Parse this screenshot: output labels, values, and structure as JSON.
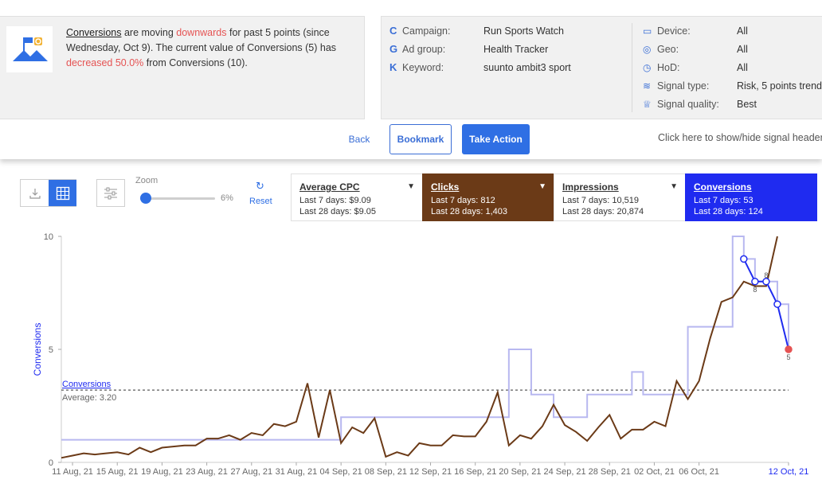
{
  "signal": {
    "metric_link": "Conversions",
    "text_1": " are moving ",
    "direction": "downwards",
    "text_2": " for past 5 points (since Wednesday, Oct 9). The current value of Conversions (5) has ",
    "change": "decreased 50.0%",
    "text_3": " from Conversions (10)."
  },
  "meta_left": [
    {
      "icon": "C",
      "label": "Campaign:",
      "value": "Run Sports Watch"
    },
    {
      "icon": "G",
      "label": "Ad group:",
      "value": "Health Tracker"
    },
    {
      "icon": "K",
      "label": "Keyword:",
      "value": "suunto ambit3 sport"
    }
  ],
  "meta_right": [
    {
      "icon": "device-icon",
      "label": "Device:",
      "value": "All"
    },
    {
      "icon": "location-pin-icon",
      "label": "Geo:",
      "value": "All"
    },
    {
      "icon": "clock-icon",
      "label": "HoD:",
      "value": "All"
    },
    {
      "icon": "signal-icon",
      "label": "Signal type:",
      "value": "Risk, 5 points trend"
    },
    {
      "icon": "trophy-icon",
      "label": "Signal quality:",
      "value": "Best"
    }
  ],
  "actions": {
    "back": "Back",
    "bookmark": "Bookmark",
    "take_action": "Take Action",
    "toggle_hint": "Click here to show/hide signal header"
  },
  "toolbar": {
    "zoom_label": "Zoom",
    "zoom_value": "6%",
    "zoom_level": 0.06,
    "reset": "Reset"
  },
  "metrics": [
    {
      "name": "Average CPC",
      "last7": "Last 7 days: $9.09",
      "last28": "Last 28 days: $9.05",
      "style": "plain"
    },
    {
      "name": "Clicks",
      "last7": "Last 7 days: 812",
      "last28": "Last 28 days: 1,403",
      "style": "clicks"
    },
    {
      "name": "Impressions",
      "last7": "Last 7 days: 10,519",
      "last28": "Last 28 days: 20,874",
      "style": "plain"
    },
    {
      "name": "Conversions",
      "last7": "Last 7 days: 53",
      "last28": "Last 28 days: 124",
      "style": "conv"
    }
  ],
  "chart_data": {
    "type": "line",
    "ylabel": "Conversions",
    "ylim": [
      0,
      10
    ],
    "yticks": [
      0,
      5,
      10
    ],
    "x_tick_labels": [
      "11 Aug, 21",
      "15 Aug, 21",
      "19 Aug, 21",
      "23 Aug, 21",
      "27 Aug, 21",
      "31 Aug, 21",
      "04 Sep, 21",
      "08 Sep, 21",
      "12 Sep, 21",
      "16 Sep, 21",
      "20 Sep, 21",
      "24 Sep, 21",
      "28 Sep, 21",
      "02 Oct, 21",
      "06 Oct, 21",
      "12 Oct, 21"
    ],
    "x_start": "10 Aug, 21",
    "x_end": "12 Oct, 21",
    "average": {
      "label": "Conversions",
      "text": "Average: 3.20",
      "value": 3.2
    },
    "colors": {
      "conversions": "#b8b8f0",
      "clicks": "#6b3a17",
      "trend": "#1f2bf0",
      "last_point": "#e55353"
    },
    "series": [
      {
        "name": "Conversions",
        "values": [
          1,
          1,
          1,
          1,
          1,
          1,
          1,
          1,
          1,
          1,
          1,
          1,
          1,
          1,
          1,
          1,
          1,
          1,
          1,
          1,
          1,
          1,
          1,
          1,
          1,
          2,
          2,
          2,
          2,
          2,
          2,
          2,
          2,
          2,
          2,
          2,
          2,
          2,
          2,
          2,
          5,
          5,
          3,
          3,
          2,
          2,
          2,
          3,
          3,
          3,
          3,
          4,
          3,
          3,
          3,
          3,
          6,
          6,
          6,
          6,
          10,
          9,
          8,
          8,
          7,
          5
        ]
      },
      {
        "name": "Clicks",
        "values": [
          0.2,
          0.3,
          0.4,
          0.35,
          0.4,
          0.45,
          0.35,
          0.65,
          0.45,
          0.65,
          0.7,
          0.75,
          0.75,
          1.05,
          1.05,
          1.2,
          1,
          1.3,
          1.2,
          1.7,
          1.6,
          1.8,
          3.5,
          1.1,
          3.2,
          0.85,
          1.55,
          1.3,
          1.95,
          0.25,
          0.45,
          0.3,
          0.85,
          0.75,
          0.75,
          1.2,
          1.15,
          1.15,
          1.8,
          3.1,
          0.75,
          1.2,
          1.05,
          1.6,
          2.55,
          1.65,
          1.35,
          0.95,
          1.55,
          2.1,
          1.05,
          1.45,
          1.45,
          1.8,
          1.6,
          3.6,
          2.8,
          3.6,
          5.5,
          7.1,
          7.3,
          8,
          7.8,
          7.8,
          10
        ]
      }
    ],
    "trend": {
      "x_index": [
        61,
        62,
        63,
        64,
        65
      ],
      "values": [
        9,
        8,
        8,
        7,
        5
      ],
      "point_labels": [
        "",
        "8",
        "8",
        "",
        "5"
      ]
    }
  }
}
